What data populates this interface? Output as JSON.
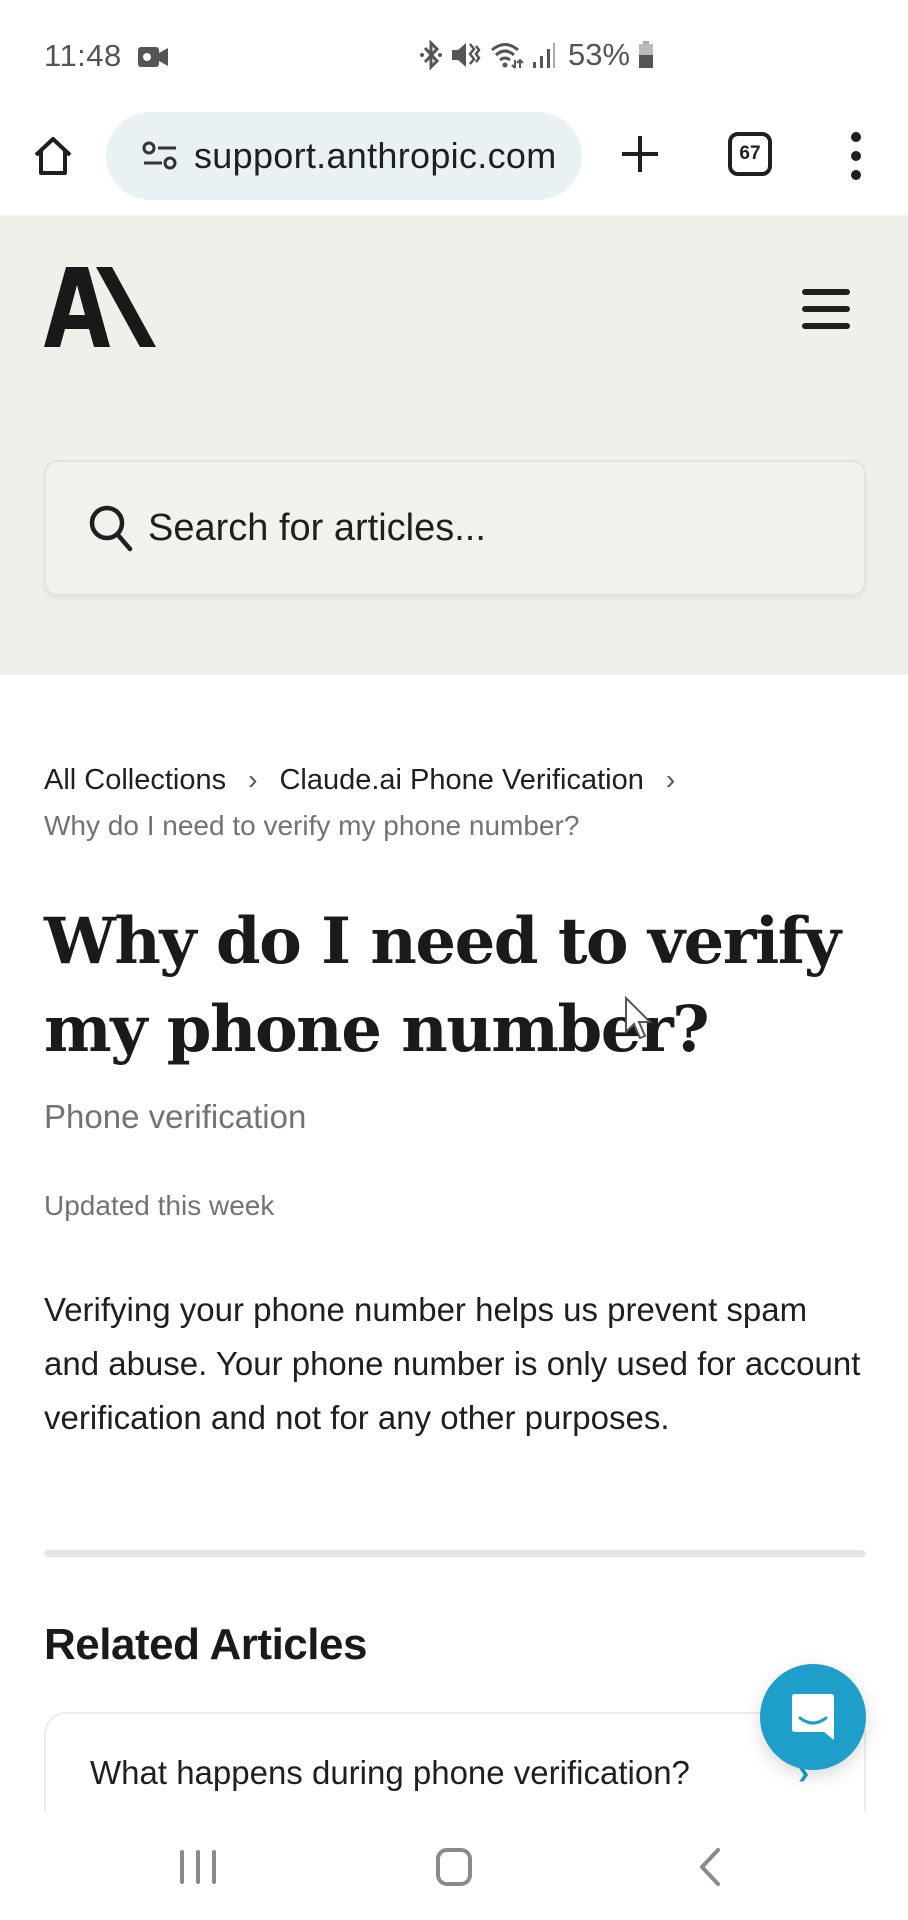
{
  "status_bar": {
    "time": "11:48",
    "battery_percent": "53%",
    "icons": [
      "screen-record-icon",
      "bluetooth-icon",
      "mute-icon",
      "wifi-icon",
      "signal-icon",
      "battery-icon"
    ]
  },
  "browser": {
    "url": "support.anthropic.com",
    "tab_count": "67",
    "icons": [
      "home-icon",
      "site-settings-icon",
      "new-tab-icon",
      "tab-switcher-icon",
      "more-menu-icon"
    ]
  },
  "header": {
    "logo_text": "A\\",
    "search": {
      "placeholder": "Search for articles...",
      "value": ""
    },
    "colors": {
      "background": "#f0f0eb"
    }
  },
  "breadcrumb": {
    "items": [
      "All Collections",
      "Claude.ai Phone Verification"
    ],
    "current": "Why do I need to verify my phone number?",
    "separator": "›"
  },
  "article": {
    "title": "Why do I need to verify my phone number?",
    "description": "Phone verification",
    "updated": "Updated this week",
    "body": "Verifying your phone number helps us prevent spam and abuse. Your phone number is only used for account verification and not for any other purposes."
  },
  "related": {
    "heading": "Related Articles",
    "items": [
      {
        "title": "What happens during phone verification?"
      }
    ],
    "chevron": "›"
  },
  "chat_launcher": {
    "color": "#1d9fc9"
  },
  "nav_bar": {
    "buttons": [
      "recents",
      "home",
      "back"
    ]
  }
}
